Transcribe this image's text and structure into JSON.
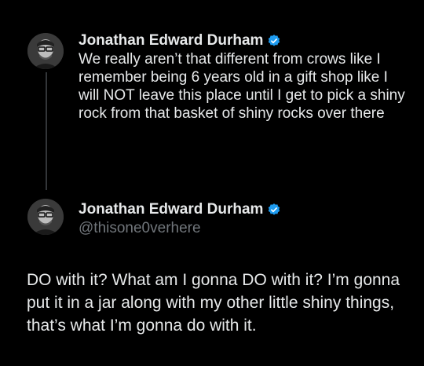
{
  "tweet1": {
    "author_name": "Jonathan Edward Durham",
    "verified_icon": "verified-badge-icon",
    "text": "We really aren’t that different from crows like I remember being 6 years old in a gift shop like I will NOT leave this place until I get to pick a shiny rock from that basket of shiny rocks over there"
  },
  "tweet2": {
    "author_name": "Jonathan Edward Durham",
    "handle": "@thisone0verhere",
    "verified_icon": "verified-badge-icon",
    "text": "DO with it? What am I gonna DO with it? I’m gonna put it in a jar along with my other little shiny things, that’s what I’m gonna do with it."
  },
  "colors": {
    "background": "#000000",
    "text": "#e7e9ea",
    "secondary_text": "#71767b",
    "verified_blue": "#1d9bf0",
    "thread_line": "#333639"
  }
}
